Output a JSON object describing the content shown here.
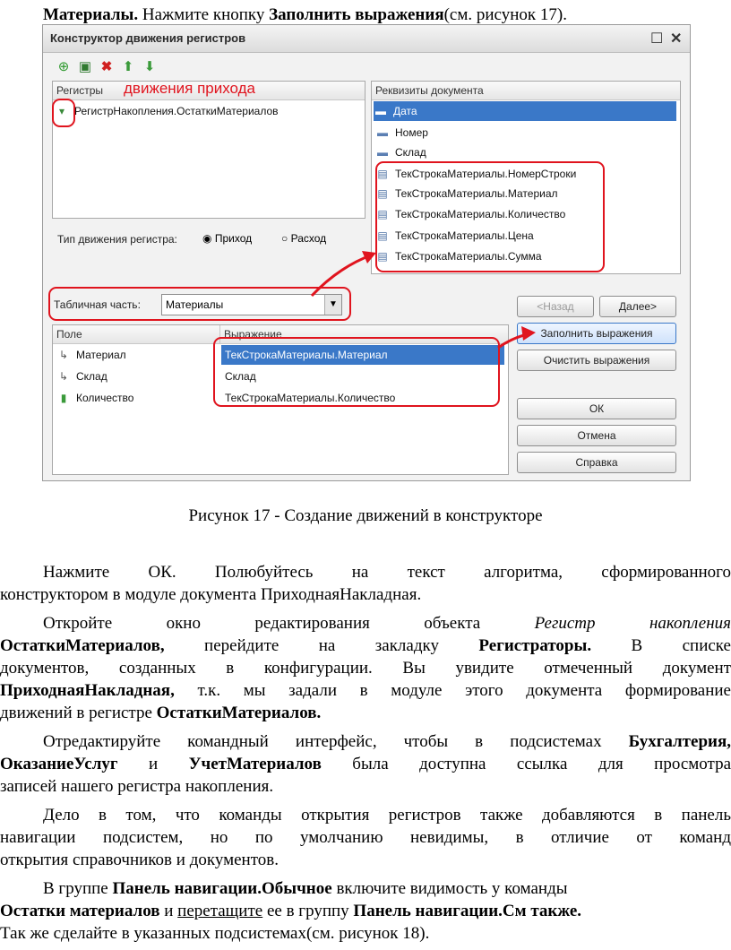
{
  "intro": {
    "b1": "Материалы.",
    "t1": " Нажмите кнопку ",
    "b2": "Заполнить выражения",
    "t2": "(см. рисунок 17)."
  },
  "dialog": {
    "title": "Конструктор движения регистров",
    "toolbar_icons": [
      "add-icon",
      "add-copy-icon",
      "delete-icon",
      "move-up-icon",
      "move-down-icon"
    ],
    "registers_header": "Регистры",
    "annotation": "движения прихода",
    "register_item": "РегистрНакопления.ОстаткиМатериалов",
    "attributes_header": "Реквизиты документа",
    "attributes": [
      "Дата",
      "Номер",
      "Склад",
      "ТекСтрокаМатериалы.НомерСтроки",
      "ТекСтрокаМатериалы.Материал",
      "ТекСтрокаМатериалы.Количество",
      "ТекСтрокаМатериалы.Цена",
      "ТекСтрокаМатериалы.Сумма"
    ],
    "movement_type_label": "Тип движения регистра:",
    "radio_income": "Приход",
    "radio_expense": "Расход",
    "tabular_label": "Табличная часть:",
    "tabular_value": "Материалы",
    "col_field": "Поле",
    "col_expr": "Выражение",
    "rows": [
      {
        "field": "Материал",
        "expr": "ТекСтрокаМатериалы.Материал"
      },
      {
        "field": "Склад",
        "expr": "Склад"
      },
      {
        "field": "Количество",
        "expr": "ТекСтрокаМатериалы.Количество"
      }
    ],
    "btn_back": "<Назад",
    "btn_next": "Далее>",
    "btn_fill": "Заполнить выражения",
    "btn_clear": "Очистить выражения",
    "btn_ok": "ОК",
    "btn_cancel": "Отмена",
    "btn_help": "Справка",
    "accent": "#3a78c8",
    "annotation_color": "#e0141e"
  },
  "caption": "Рисунок 17 - Создание движений в конструкторе",
  "p1": {
    "l1": "Нажмите ОК. Полюбуйтесь на текст алгоритма, сформированного",
    "l2": "конструктором в модуле документа ПриходнаяНакладная."
  },
  "p2": {
    "a": "Откройте окно редактирования объекта ",
    "i1": "Регистр накопления",
    "b1": "ОстаткиМатериалов,",
    "c": " перейдите на закладку ",
    "b2": "Регистраторы.",
    "d": " В списке",
    "l3": "документов, созданных в конфигурации. Вы увидите отмеченный документ",
    "b3": "ПриходнаяНакладная,",
    "e": " т.к. мы задали в модуле этого документа формирование",
    "f": "движений в регистре ",
    "b4": "ОстаткиМатериалов."
  },
  "p3": {
    "a": "Отредактируйте командный интерфейс, чтобы в подсистемах ",
    "b1": "Бухгалтерия,",
    "b2": "ОказаниеУслуг",
    "c": " и ",
    "b3": "УчетМатериалов",
    "d": " была доступна ссылка для просмотра",
    "l3": "записей нашего регистра накопления."
  },
  "p4": {
    "l1": "Дело в том, что команды открытия регистров также добавляются в панель",
    "l2": "навигации подсистем, но по умолчанию невидимы, в отличие от команд",
    "l3": "открытия справочников и документов."
  },
  "p5": {
    "a": "В группе ",
    "b1": "Панель навигации.Обычное",
    "c": " включите видимость у команды",
    "b2": "Остатки материалов",
    "d": " и ",
    "u1": "перетащите",
    "e": " ее в группу ",
    "b3": "Панель навигации.См также.",
    "l3": "Так же сделайте в указанных подсистемах(см. рисунок 18)."
  }
}
